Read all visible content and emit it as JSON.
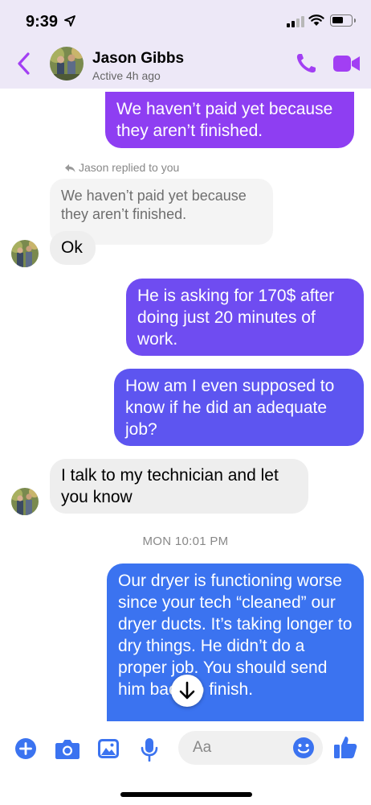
{
  "status": {
    "time": "9:39",
    "location_icon": "location-arrow-icon",
    "signal_icon": "cellular-signal-icon",
    "wifi_icon": "wifi-icon",
    "battery_icon": "battery-icon"
  },
  "header": {
    "contact_name": "Jason Gibbs",
    "presence": "Active 4h ago"
  },
  "messages": {
    "m1": "We haven’t paid yet because they aren’t finished.",
    "reply_note": "Jason replied to you",
    "quoted": "We haven’t paid yet because they aren’t finished.",
    "m2": "Ok",
    "m3": "He is asking for 170$ after doing just 20 minutes of work.",
    "m4": "How am I even supposed to know if he did an adequate job?",
    "m5": "I talk to my technician and let you know",
    "timestamp": "MON 10:01 PM",
    "m6": "Our dryer is functioning worse since your tech “cleaned” our dryer ducts. It’s taking longer to dry things. He didn’t do a proper job. You should send him back to finish."
  },
  "composer": {
    "placeholder": "Aa"
  },
  "colors": {
    "accent": "#a23ff3",
    "bubble_purple": "#8e3ef2",
    "bubble_indigo": "#6a4ef0",
    "bubble_blue": "#3b73f0",
    "incoming": "#eeeeee"
  }
}
